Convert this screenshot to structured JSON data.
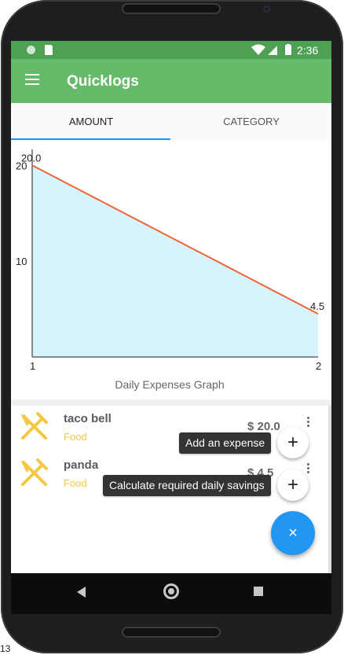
{
  "status_bar": {
    "time": "2:36",
    "icons": [
      "notification-circle-icon",
      "sd-card-icon",
      "wifi-icon",
      "signal-icon",
      "battery-icon"
    ]
  },
  "app_bar": {
    "title": "Quicklogs",
    "menu_icon": "menu-icon"
  },
  "tabs": [
    {
      "label": "AMOUNT",
      "active": true
    },
    {
      "label": "CATEGORY",
      "active": false
    }
  ],
  "chart_data": {
    "type": "area",
    "title": "Daily Expenses Graph",
    "x": [
      1,
      2
    ],
    "series": [
      {
        "values": [
          20.0,
          4.5
        ]
      }
    ],
    "data_labels": [
      "20.0",
      "4.5"
    ],
    "x_tick_labels": [
      "1",
      "2"
    ],
    "y_tick_labels": [
      "10",
      "20"
    ],
    "ylim": [
      0,
      21.5
    ],
    "xlim": [
      1,
      2
    ],
    "line_color": "#f0643c",
    "fill_color": "#d6f4fb",
    "grid": false
  },
  "expenses": [
    {
      "name": "taco bell",
      "category": "Food",
      "amount": "$ 20.0",
      "icon": "fork-knife-icon"
    },
    {
      "name": "panda",
      "category": "Food",
      "amount": "$ 4.5",
      "icon": "fork-knife-icon"
    }
  ],
  "speed_dial": {
    "add_expense_tooltip": "Add an expense",
    "savings_tooltip": "Calculate required daily savings",
    "add_glyph": "+",
    "close_glyph": "×"
  },
  "corner_label": "13"
}
